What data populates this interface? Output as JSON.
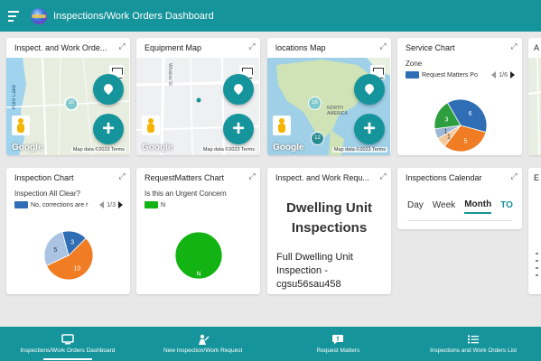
{
  "app": {
    "title": "Inspections/Work Orders Dashboard"
  },
  "cards": {
    "inspect_map": {
      "title": "Inspect. and Work Orde...",
      "street_label": "Pure Lake",
      "marker": "10",
      "google": "Google",
      "attribution": "Map data ©2023 Terms"
    },
    "equipment_map": {
      "title": "Equipment Map",
      "street_label": "Winslow St",
      "google": "Google",
      "attribution": "Map data ©2023 Terms"
    },
    "locations_map": {
      "title": "locations Map",
      "region_label": "NORTH AMERICA",
      "markers": [
        "16",
        "12"
      ],
      "google": "Google",
      "attribution": "Map data ©2023 Terms"
    },
    "service_chart": {
      "title": "Service Chart",
      "legend_heading": "Zone",
      "legend_label": "Request Matters Po",
      "pager": "1/6"
    },
    "inspection_chart": {
      "title": "Inspection Chart",
      "legend_heading": "Inspection All Clear?",
      "legend_label": "No, corrections are r",
      "pager": "1/3"
    },
    "requestmatters_chart": {
      "title": "RequestMatters Chart",
      "legend_heading": "Is this an Urgent Concern",
      "legend_label": "N"
    },
    "inspect_doc": {
      "title": "Inspect. and Work Requ...",
      "heading": "Dwelling Unit Inspections",
      "body": "Full Dwelling Unit Inspection - cgsu56sau458"
    },
    "calendar": {
      "title": "Inspections Calendar",
      "tabs": [
        "Day",
        "Week",
        "Month",
        "TO"
      ],
      "active_tab": "Month"
    },
    "partial_top": {
      "title": "A"
    },
    "partial_bottom": {
      "title": "E"
    }
  },
  "chart_data": [
    {
      "type": "pie",
      "title": "Service Chart",
      "labels": [
        "",
        "",
        "",
        "",
        ""
      ],
      "values": [
        6,
        5,
        1,
        1,
        3
      ],
      "colors": [
        "#2f6eb5",
        "#f07d23",
        "#f4c89a",
        "#9db7d8",
        "#2e9f3e"
      ]
    },
    {
      "type": "pie",
      "title": "Inspection Chart",
      "labels": [
        "",
        "",
        ""
      ],
      "values": [
        10,
        5,
        3
      ],
      "colors": [
        "#f07d23",
        "#aac3e3",
        "#2f6eb5"
      ]
    },
    {
      "type": "pie",
      "title": "RequestMatters Chart",
      "labels": [
        "N"
      ],
      "values": [
        1
      ],
      "colors": [
        "#12b312"
      ]
    }
  ],
  "bottom_nav": [
    {
      "label": "Inspections/Work Orders Dashboard",
      "icon": "monitor-icon",
      "active": true
    },
    {
      "label": "New Inspection/Work Request",
      "icon": "worker-icon",
      "active": false
    },
    {
      "label": "Request Matters",
      "icon": "chat-alert-icon",
      "active": false
    },
    {
      "label": "Inspections and Work Orders List",
      "icon": "list-icon",
      "active": false
    }
  ],
  "colors": {
    "primary": "#16949b",
    "pie_blue": "#2f6eb5",
    "pie_orange": "#f07d23",
    "pie_green": "#2e9f3e",
    "pie_light_blue": "#aac3e3"
  }
}
